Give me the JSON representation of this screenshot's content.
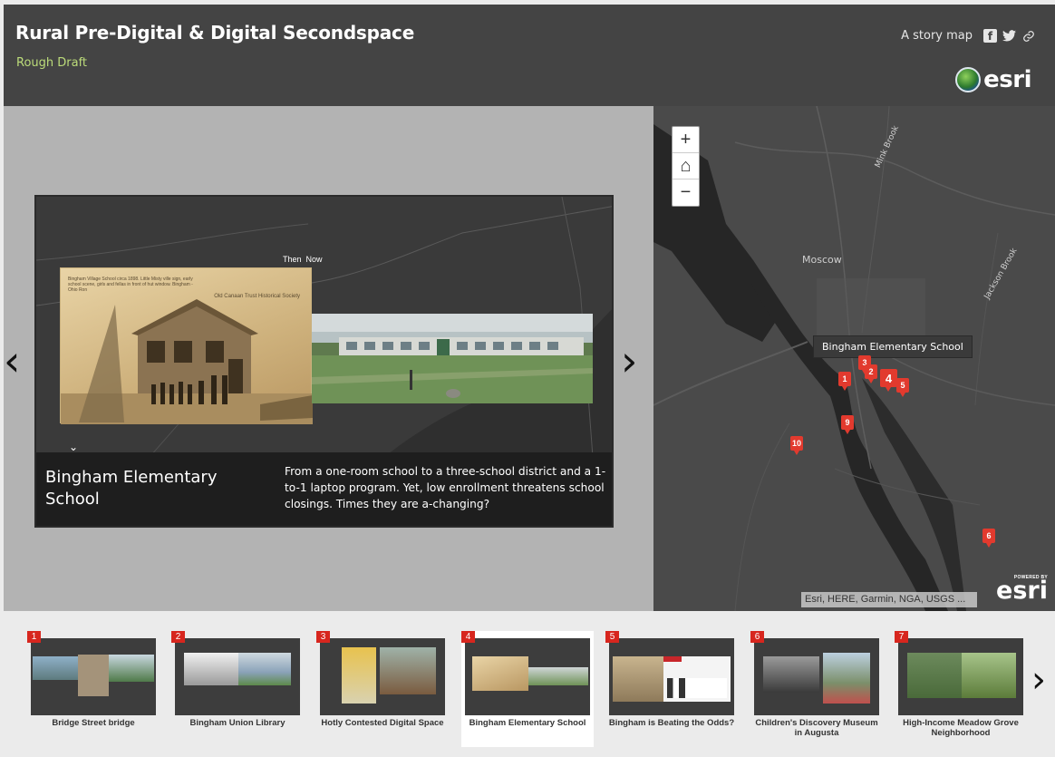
{
  "header": {
    "title": "Rural Pre-Digital & Digital Secondspace",
    "subtitle": "Rough Draft",
    "story_map_label": "A story map",
    "logo_text": "esri"
  },
  "colors": {
    "header_bg": "#444444",
    "subtitle": "#bcdc7a",
    "marker": "#e23a2e",
    "map_bg": "#4a4a4a"
  },
  "media": {
    "then_label": "Then",
    "now_label": "Now",
    "old_photo_caption": "Bingham Village School circa 1898. Little Misty ville sign, early school scene, girls and fellas in front of hut window. Bingham - Ohio Ron",
    "old_photo_society": "Old Canaan Trust Historical Society",
    "entry_title": "Bingham Elementary School",
    "entry_description": "From a one-room school to a three-school district and a 1-to-1 laptop program. Yet, low enrollment threatens school closings. Times they are a-changing?"
  },
  "map": {
    "label_moscow": "Moscow",
    "label_mink_brook": "Mink Brook",
    "label_jackson_brook": "Jackson Brook",
    "tooltip": "Bingham Elementary School",
    "attribution": "Esri, HERE, Garmin, NGA, USGS ...",
    "powered_by": "POWERED BY",
    "powered_logo": "esri",
    "markers": [
      "1",
      "2",
      "3",
      "4",
      "5",
      "9",
      "10",
      "6"
    ]
  },
  "carousel": {
    "items": [
      {
        "num": "1",
        "label": "Bridge Street bridge"
      },
      {
        "num": "2",
        "label": "Bingham Union Library"
      },
      {
        "num": "3",
        "label": "Hotly Contested Digital Space"
      },
      {
        "num": "4",
        "label": "Bingham Elementary School"
      },
      {
        "num": "5",
        "label": "Bingham is Beating the Odds?"
      },
      {
        "num": "6",
        "label": "Children's Discovery Museum in Augusta"
      },
      {
        "num": "7",
        "label": "High-Income Meadow Grove Neighborhood"
      }
    ]
  }
}
